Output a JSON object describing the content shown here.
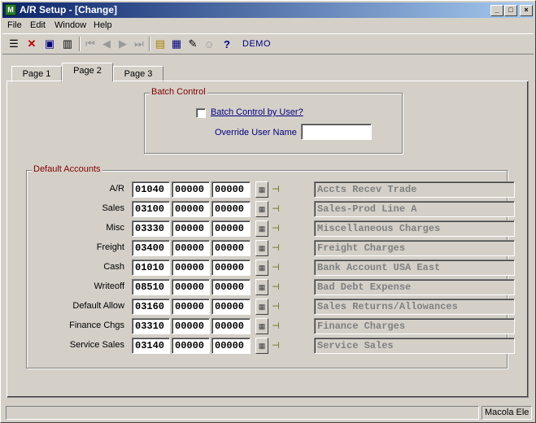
{
  "window": {
    "title": "A/R Setup - [Change]",
    "icon": "app-icon",
    "controls": [
      "minimize-icon",
      "maximize-icon",
      "close-icon"
    ]
  },
  "menu": [
    "File",
    "Edit",
    "Window",
    "Help"
  ],
  "toolbar": {
    "company": "DEMO",
    "tools": [
      "list-icon",
      "delete-icon",
      "save-icon",
      "trash-icon",
      "first-record-icon",
      "prev-record-icon",
      "next-record-icon",
      "last-record-icon",
      "note-icon",
      "calculator-icon",
      "chart-icon",
      "people-icon",
      "help-icon"
    ]
  },
  "tabs": [
    {
      "label": "Page 1",
      "active": false
    },
    {
      "label": "Page 2",
      "active": true
    },
    {
      "label": "Page 3",
      "active": false
    }
  ],
  "batch_control": {
    "title": "Batch Control",
    "checkbox_label": "Batch Control by User?",
    "checked": false,
    "override_label": "Override User Name",
    "override_value": ""
  },
  "default_accounts": {
    "title": "Default Accounts",
    "rows": [
      {
        "label": "A/R",
        "segments": [
          "01040",
          "00000",
          "00000"
        ],
        "description": "Accts Recev Trade"
      },
      {
        "label": "Sales",
        "segments": [
          "03100",
          "00000",
          "00000"
        ],
        "description": "Sales-Prod Line A"
      },
      {
        "label": "Misc",
        "segments": [
          "03330",
          "00000",
          "00000"
        ],
        "description": "Miscellaneous Charges"
      },
      {
        "label": "Freight",
        "segments": [
          "03400",
          "00000",
          "00000"
        ],
        "description": "Freight Charges"
      },
      {
        "label": "Cash",
        "segments": [
          "01010",
          "00000",
          "00000"
        ],
        "description": "Bank Account USA East"
      },
      {
        "label": "Writeoff",
        "segments": [
          "08510",
          "00000",
          "00000"
        ],
        "description": "Bad Debt Expense"
      },
      {
        "label": "Default Allow",
        "segments": [
          "03160",
          "00000",
          "00000"
        ],
        "description": "Sales Returns/Allowances"
      },
      {
        "label": "Finance Chgs",
        "segments": [
          "03310",
          "00000",
          "00000"
        ],
        "description": "Finance Charges"
      },
      {
        "label": "Service Sales",
        "segments": [
          "03140",
          "00000",
          "00000"
        ],
        "description": "Service Sales"
      }
    ]
  },
  "status": {
    "main": "",
    "right": "Macola Ele"
  }
}
